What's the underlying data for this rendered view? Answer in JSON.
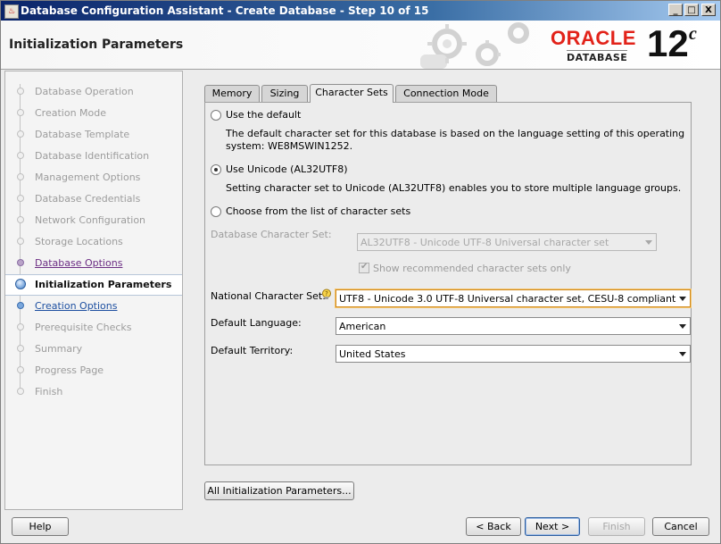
{
  "window": {
    "title": "Database Configuration Assistant - Create Database - Step 10 of 15",
    "minimize": "_",
    "maximize": "□",
    "close": "X"
  },
  "header": {
    "page_title": "Initialization Parameters",
    "logo_oracle": "ORACLE",
    "logo_database": "DATABASE",
    "logo_version": "12",
    "logo_suffix": "c"
  },
  "steps": [
    {
      "label": "Database Operation",
      "state": "pending"
    },
    {
      "label": "Creation Mode",
      "state": "pending"
    },
    {
      "label": "Database Template",
      "state": "pending"
    },
    {
      "label": "Database Identification",
      "state": "pending"
    },
    {
      "label": "Management Options",
      "state": "pending"
    },
    {
      "label": "Database Credentials",
      "state": "pending"
    },
    {
      "label": "Network Configuration",
      "state": "pending"
    },
    {
      "label": "Storage Locations",
      "state": "pending"
    },
    {
      "label": "Database Options",
      "state": "done"
    },
    {
      "label": "Initialization Parameters",
      "state": "current"
    },
    {
      "label": "Creation Options",
      "state": "next"
    },
    {
      "label": "Prerequisite Checks",
      "state": "pending"
    },
    {
      "label": "Summary",
      "state": "pending"
    },
    {
      "label": "Progress Page",
      "state": "pending"
    },
    {
      "label": "Finish",
      "state": "pending"
    }
  ],
  "tabs": [
    {
      "label": "Memory"
    },
    {
      "label": "Sizing"
    },
    {
      "label": "Character Sets",
      "active": true
    },
    {
      "label": "Connection Mode"
    }
  ],
  "charset": {
    "option_default_label": "Use the default",
    "option_default_desc_line1": "The default character set for this database is based on the language setting of this operating",
    "option_default_desc_line2": "system: WE8MSWIN1252.",
    "option_unicode_label": "Use Unicode (AL32UTF8)",
    "option_unicode_desc": "Setting character set to Unicode (AL32UTF8) enables you to store multiple language groups.",
    "option_choose_label": "Choose from the list of character sets",
    "selected_option": "unicode",
    "db_charset_label": "Database Character Set:",
    "db_charset_value": "AL32UTF8 - Unicode UTF-8 Universal character set",
    "show_recommended_label": "Show recommended character sets only",
    "show_recommended_checked": true,
    "national_label": "National Character Set:",
    "national_value": "UTF8 - Unicode 3.0 UTF-8 Universal character set, CESU-8 compliant",
    "language_label": "Default Language:",
    "language_value": "American",
    "territory_label": "Default Territory:",
    "territory_value": "United States"
  },
  "all_params_button": "All Initialization Parameters...",
  "footer": {
    "help": "Help",
    "back": "< Back",
    "next": "Next >",
    "finish": "Finish",
    "cancel": "Cancel"
  },
  "colors": {
    "title_bar": "#0a246a",
    "oracle_red": "#e2231a",
    "done_step": "#6b2c83",
    "next_step": "#1d4fa0"
  }
}
